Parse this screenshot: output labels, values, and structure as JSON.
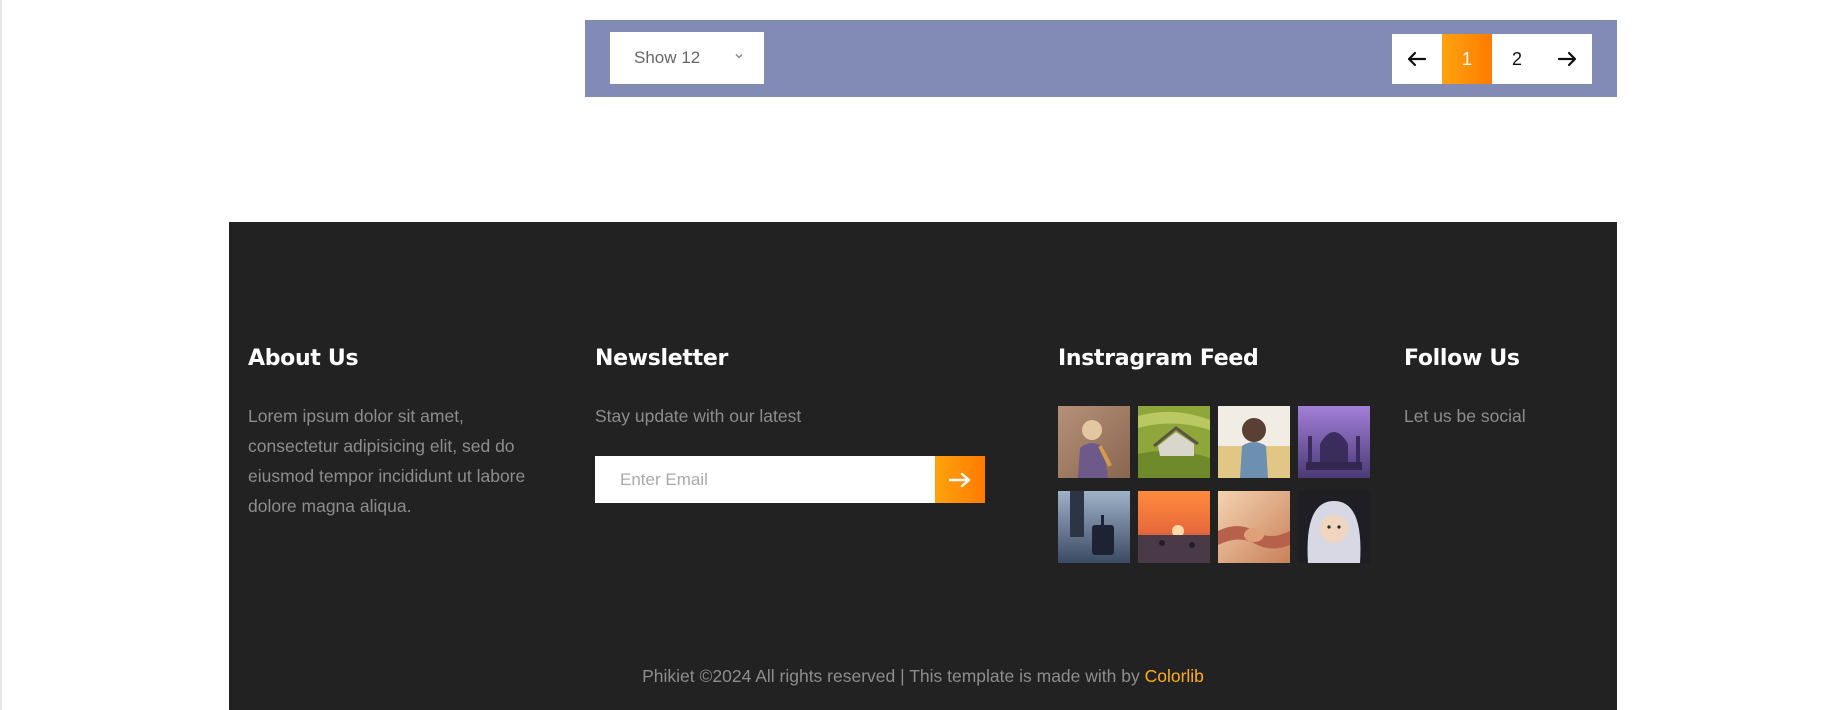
{
  "filter_bar": {
    "show_select": {
      "value": "Show 12"
    },
    "pagination": {
      "prev_icon": "arrow-left-icon",
      "pages": [
        "1",
        "2"
      ],
      "active_page": "1",
      "next_icon": "arrow-right-icon"
    }
  },
  "footer": {
    "about": {
      "title": "About Us",
      "text": "Lorem ipsum dolor sit amet, consectetur adipisicing elit, sed do eiusmod tempor incididunt ut labore dolore magna aliqua."
    },
    "newsletter": {
      "title": "Newsletter",
      "text": "Stay update with our latest",
      "email_placeholder": "Enter Email",
      "submit_icon": "arrow-right-icon"
    },
    "instagram": {
      "title": "Instragram Feed",
      "images": [
        "child-in-jacket-photo",
        "hut-in-field-photo",
        "girl-from-behind-photo",
        "purple-palace-photo",
        "traveler-with-suitcase-photo",
        "sunset-sea-photo",
        "holding-hands-photo",
        "child-in-hood-photo"
      ]
    },
    "follow": {
      "title": "Follow Us",
      "text": "Let us be social"
    },
    "copyright": {
      "text": "Phikiet ©2024 All rights reserved | This template is made with  by ",
      "link": "Colorlib"
    }
  },
  "colors": {
    "accent_start": "#ffa30e",
    "accent_end": "#ff7b00",
    "filter_bar_bg": "#828bb5",
    "footer_bg": "#222222",
    "link": "#ffad1f"
  }
}
